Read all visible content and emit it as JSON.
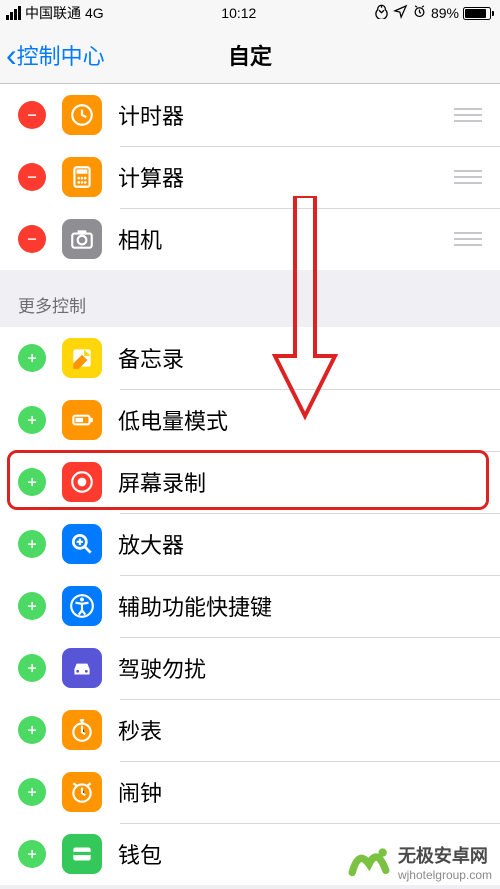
{
  "status": {
    "carrier": "中国联通",
    "network": "4G",
    "time": "10:12",
    "battery_pct": "89%",
    "battery_fill_pct": 89
  },
  "nav": {
    "back_label": "控制中心",
    "title": "自定"
  },
  "included": [
    {
      "label": "计时器",
      "icon": "timer-icon",
      "color": "#ff9500"
    },
    {
      "label": "计算器",
      "icon": "calculator-icon",
      "color": "#ff9500"
    },
    {
      "label": "相机",
      "icon": "camera-icon",
      "color": "#8e8e93"
    }
  ],
  "more_header": "更多控制",
  "more": [
    {
      "label": "备忘录",
      "icon": "notes-icon",
      "color": "#ffd60a"
    },
    {
      "label": "低电量模式",
      "icon": "lowpower-icon",
      "color": "#ff9500"
    },
    {
      "label": "屏幕录制",
      "icon": "record-icon",
      "color": "#ff3b30"
    },
    {
      "label": "放大器",
      "icon": "magnifier-icon",
      "color": "#007aff"
    },
    {
      "label": "辅助功能快捷键",
      "icon": "accessibility-icon",
      "color": "#007aff"
    },
    {
      "label": "驾驶勿扰",
      "icon": "driving-icon",
      "color": "#5856d6"
    },
    {
      "label": "秒表",
      "icon": "stopwatch-icon",
      "color": "#ff9500"
    },
    {
      "label": "闹钟",
      "icon": "alarm-icon",
      "color": "#ff9500"
    },
    {
      "label": "钱包",
      "icon": "wallet-icon",
      "color": "#34c759"
    }
  ],
  "watermark": {
    "main": "无极安卓网",
    "sub": "wjhotelgroup.com"
  }
}
